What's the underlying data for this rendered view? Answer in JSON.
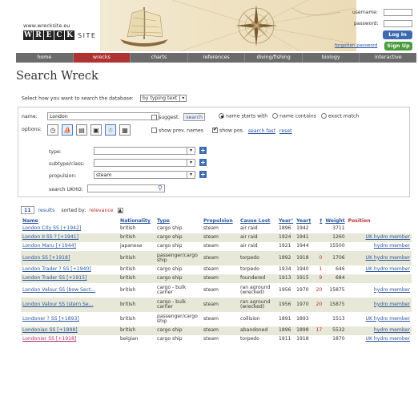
{
  "site": {
    "url": "www.wrecksite.eu",
    "logo_letters": [
      "W",
      "R",
      "E",
      "C",
      "K"
    ],
    "logo_suffix": "SITE"
  },
  "login": {
    "username_label": "username:",
    "password_label": "password:",
    "login_button": "Log In",
    "forgot_link": "forgotten password",
    "signup_button": "Sign Up"
  },
  "nav": [
    {
      "label": "home"
    },
    {
      "label": "wrecks"
    },
    {
      "label": "charts"
    },
    {
      "label": "references"
    },
    {
      "label": "diving/fishing"
    },
    {
      "label": "biology"
    },
    {
      "label": "interactive"
    }
  ],
  "nav_active": "wrecks",
  "page_title": "Search Wreck",
  "method": {
    "label": "Select how you want to search the database:",
    "value": "by typing text"
  },
  "search": {
    "name_label": "name:",
    "name_value": "London",
    "suggest_label": "suggest.",
    "search_button": "search",
    "match_options": [
      "name starts with",
      "name contains",
      "exact match"
    ],
    "match_selected": "name starts with",
    "options_label": "options:",
    "show_prev_names": "show prev. names",
    "show_pos": "show pos.",
    "search_fast": "search fast",
    "reset": "reset",
    "type_label": "type:",
    "type_value": "",
    "subtype_label": "subtype/class:",
    "subtype_value": "",
    "propulsion_label": "propulsion:",
    "propulsion_value": "steam",
    "ukho_label": "search UKHO:",
    "ukho_value": ""
  },
  "results": {
    "count": "11",
    "results_label": "results",
    "sorted_label": "sorted by:",
    "sorted_value": "relevance"
  },
  "columns": [
    "Name",
    "Nationality",
    "Type",
    "Propulsion",
    "Cause Lost",
    "Year°",
    "Year†",
    "†",
    "Weight",
    "Position"
  ],
  "rows": [
    {
      "name": "London City SS [+1942]",
      "nat": "british",
      "type": "cargo ship",
      "prop": "steam",
      "cause": "air raid",
      "y1": "1896",
      "y2": "1942",
      "dead": "",
      "weight": "3711",
      "pos": ""
    },
    {
      "name": "London II SS ? [+1941]",
      "nat": "british",
      "type": "cargo ship",
      "prop": "steam",
      "cause": "air raid",
      "y1": "1924",
      "y2": "1941",
      "dead": "",
      "weight": "1260",
      "pos": "UK hydro member"
    },
    {
      "name": "London Maru [+1944]",
      "nat": "japanese",
      "type": "cargo ship",
      "prop": "steam",
      "cause": "air raid",
      "y1": "1921",
      "y2": "1944",
      "dead": "",
      "weight": "15500",
      "pos": "hydro member"
    },
    {
      "name": "London SS [+1918]",
      "nat": "british",
      "type": "passenger/cargo ship",
      "prop": "steam",
      "cause": "torpedo",
      "y1": "1892",
      "y2": "1918",
      "dead": "0",
      "weight": "1706",
      "pos": "UK hydro member"
    },
    {
      "name": "London Trader ? SS [+1940]",
      "nat": "british",
      "type": "cargo ship",
      "prop": "steam",
      "cause": "torpedo",
      "y1": "1934",
      "y2": "1940",
      "dead": "1",
      "weight": "646",
      "pos": "UK hydro member"
    },
    {
      "name": "London Trader SS [+1915]",
      "nat": "british",
      "type": "cargo ship",
      "prop": "steam",
      "cause": "foundered",
      "y1": "1913",
      "y2": "1915",
      "dead": "9",
      "weight": "684",
      "pos": ""
    },
    {
      "name": "London Valour SS (bow Sect...",
      "nat": "british",
      "type": "cargo - bulk carrier",
      "prop": "steam",
      "cause": "ran aground (wrecked)",
      "y1": "1956",
      "y2": "1970",
      "dead": "20",
      "weight": "15875",
      "pos": "hydro member"
    },
    {
      "name": "London Valour SS (stern Se...",
      "nat": "british",
      "type": "cargo - bulk carrier",
      "prop": "steam",
      "cause": "ran aground (wrecked)",
      "y1": "1956",
      "y2": "1970",
      "dead": "20",
      "weight": "15875",
      "pos": "hydro member"
    },
    {
      "name": "Londoner ? SS [+1893]",
      "nat": "british",
      "type": "passenger/cargo ship",
      "prop": "steam",
      "cause": "collision",
      "y1": "1891",
      "y2": "1893",
      "dead": "",
      "weight": "1513",
      "pos": "UK hydro member"
    },
    {
      "name": "Londonian SS [+1898]",
      "nat": "british",
      "type": "cargo ship",
      "prop": "steam",
      "cause": "abandoned",
      "y1": "1896",
      "y2": "1898",
      "dead": "17",
      "weight": "5532",
      "pos": "hydro member"
    },
    {
      "name": "Londonier SS [+1918]",
      "nat": "belgian",
      "type": "cargo ship",
      "prop": "steam",
      "cause": "torpedo",
      "y1": "1911",
      "y2": "1918",
      "dead": "",
      "weight": "1870",
      "pos": "UK hydro member"
    }
  ],
  "colors": {
    "nav_bg": "#6b6b6b",
    "nav_active": "#b03333",
    "link": "#2a55a0",
    "row_alt": "#e8e8d8",
    "login_btn": "#3d6bb3",
    "signup_btn": "#4a9c3d"
  }
}
